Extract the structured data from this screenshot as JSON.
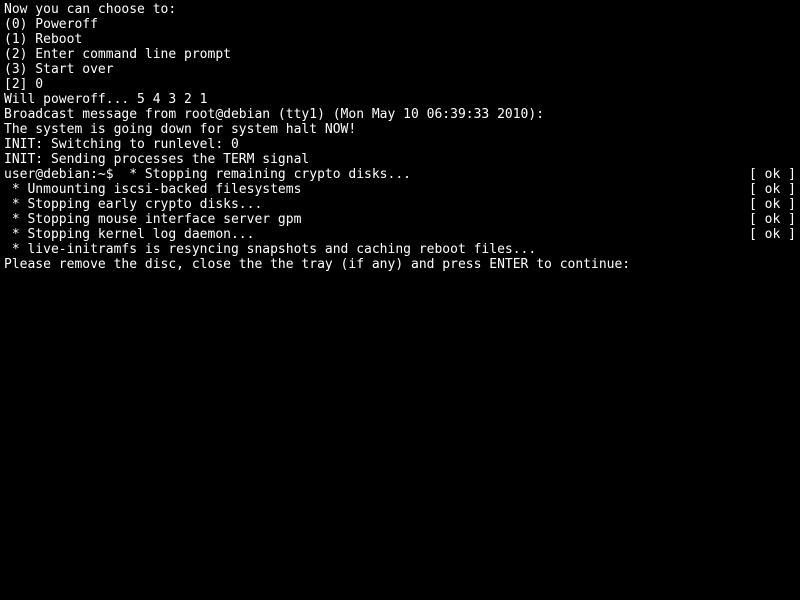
{
  "menu": {
    "header": "Now you can choose to:",
    "options": [
      "(0) Poweroff",
      "(1) Reboot",
      "(2) Enter command line prompt",
      "(3) Start over"
    ],
    "prompt": "[2] 0"
  },
  "poweroff": {
    "countdown": "Will poweroff... 5 4 3 2 1",
    "broadcast": "Broadcast message from root@debian (tty1) (Mon May 10 06:39:33 2010):"
  },
  "halt": {
    "blank": "",
    "msg": "The system is going down for system halt NOW!",
    "init1": "INIT: Switching to runlevel: 0",
    "init2": "INIT: Sending processes the TERM signal"
  },
  "services": [
    {
      "left": "user@debian:~$  * Stopping remaining crypto disks...",
      "right": "[ ok ]"
    },
    {
      "left": " * Unmounting iscsi-backed filesystems",
      "right": "[ ok ]"
    },
    {
      "left": " * Stopping early crypto disks...",
      "right": "[ ok ]"
    },
    {
      "left": " * Stopping mouse interface server gpm",
      "right": "[ ok ]"
    },
    {
      "left": " * Stopping kernel log daemon...",
      "right": "[ ok ]"
    }
  ],
  "resync": " * live-initramfs is resyncing snapshots and caching reboot files...",
  "final": {
    "blank": "",
    "prompt": "Please remove the disc, close the the tray (if any) and press ENTER to continue:"
  }
}
